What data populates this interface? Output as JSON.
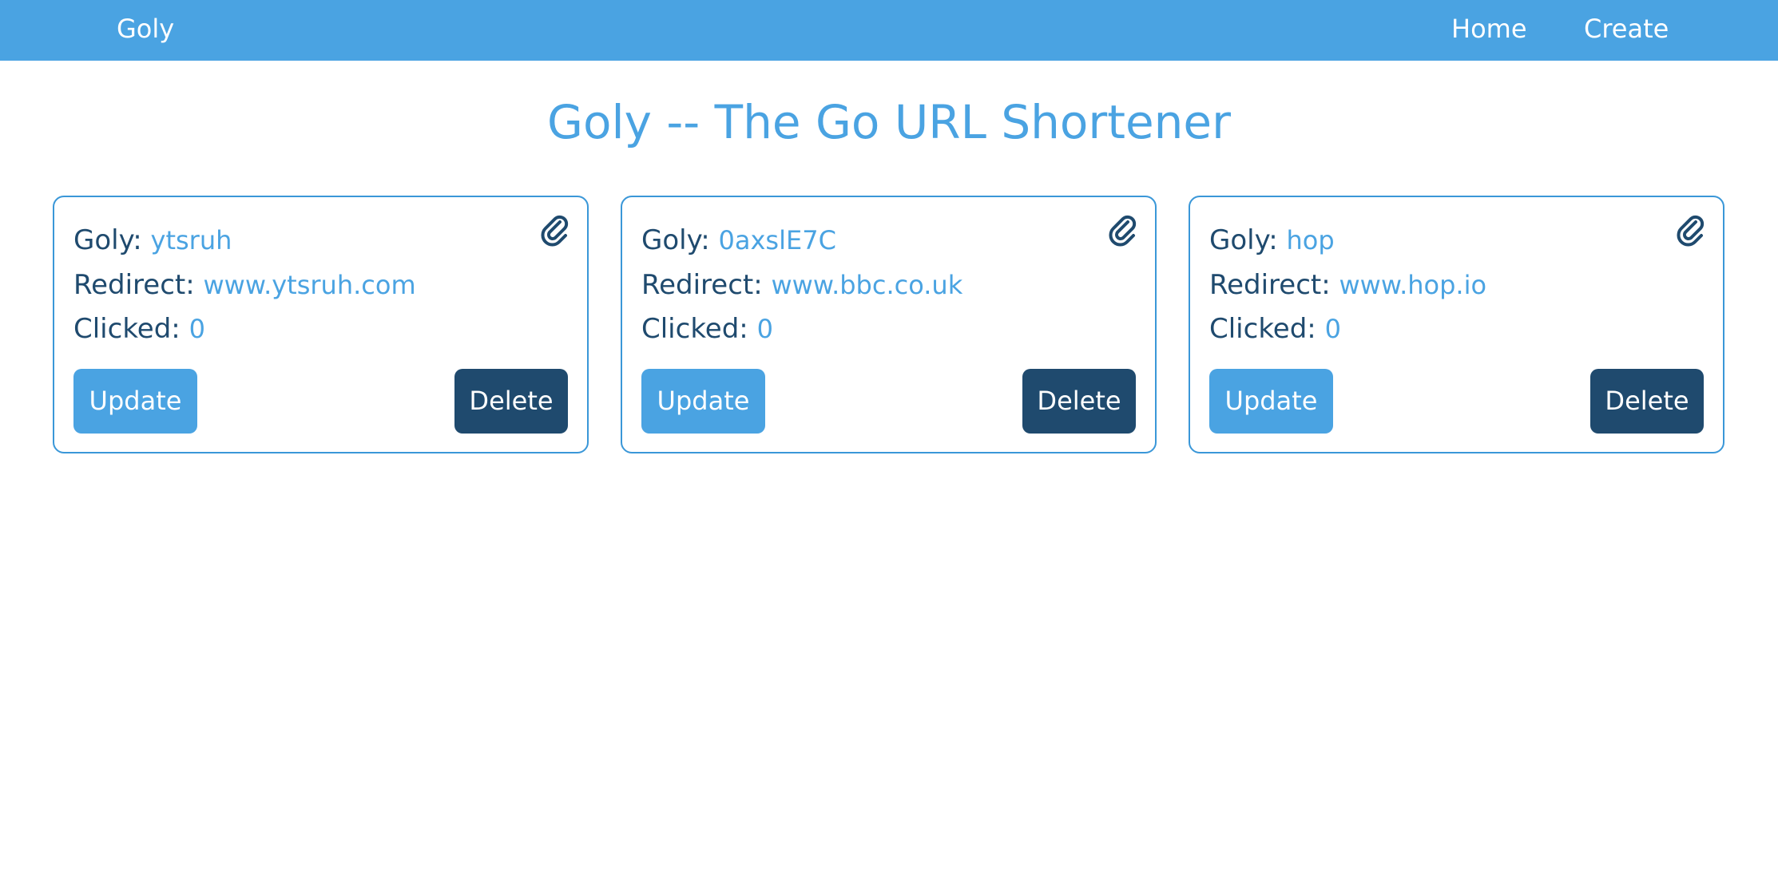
{
  "nav": {
    "brand": "Goly",
    "home_label": "Home",
    "create_label": "Create"
  },
  "page": {
    "title": "Goly -- The Go URL Shortener"
  },
  "labels": {
    "goly": "Goly:",
    "redirect": "Redirect:",
    "clicked": "Clicked:",
    "update": "Update",
    "delete": "Delete"
  },
  "cards": [
    {
      "goly": "ytsruh",
      "redirect": "www.ytsruh.com",
      "clicked": "0"
    },
    {
      "goly": "0axslE7C",
      "redirect": "www.bbc.co.uk",
      "clicked": "0"
    },
    {
      "goly": "hop",
      "redirect": "www.hop.io",
      "clicked": "0"
    }
  ],
  "icons": {
    "copy": "paperclip-icon"
  },
  "colors": {
    "primary": "#4aa3e2",
    "dark": "#1f4a6e",
    "card_border": "#3a97d8"
  }
}
